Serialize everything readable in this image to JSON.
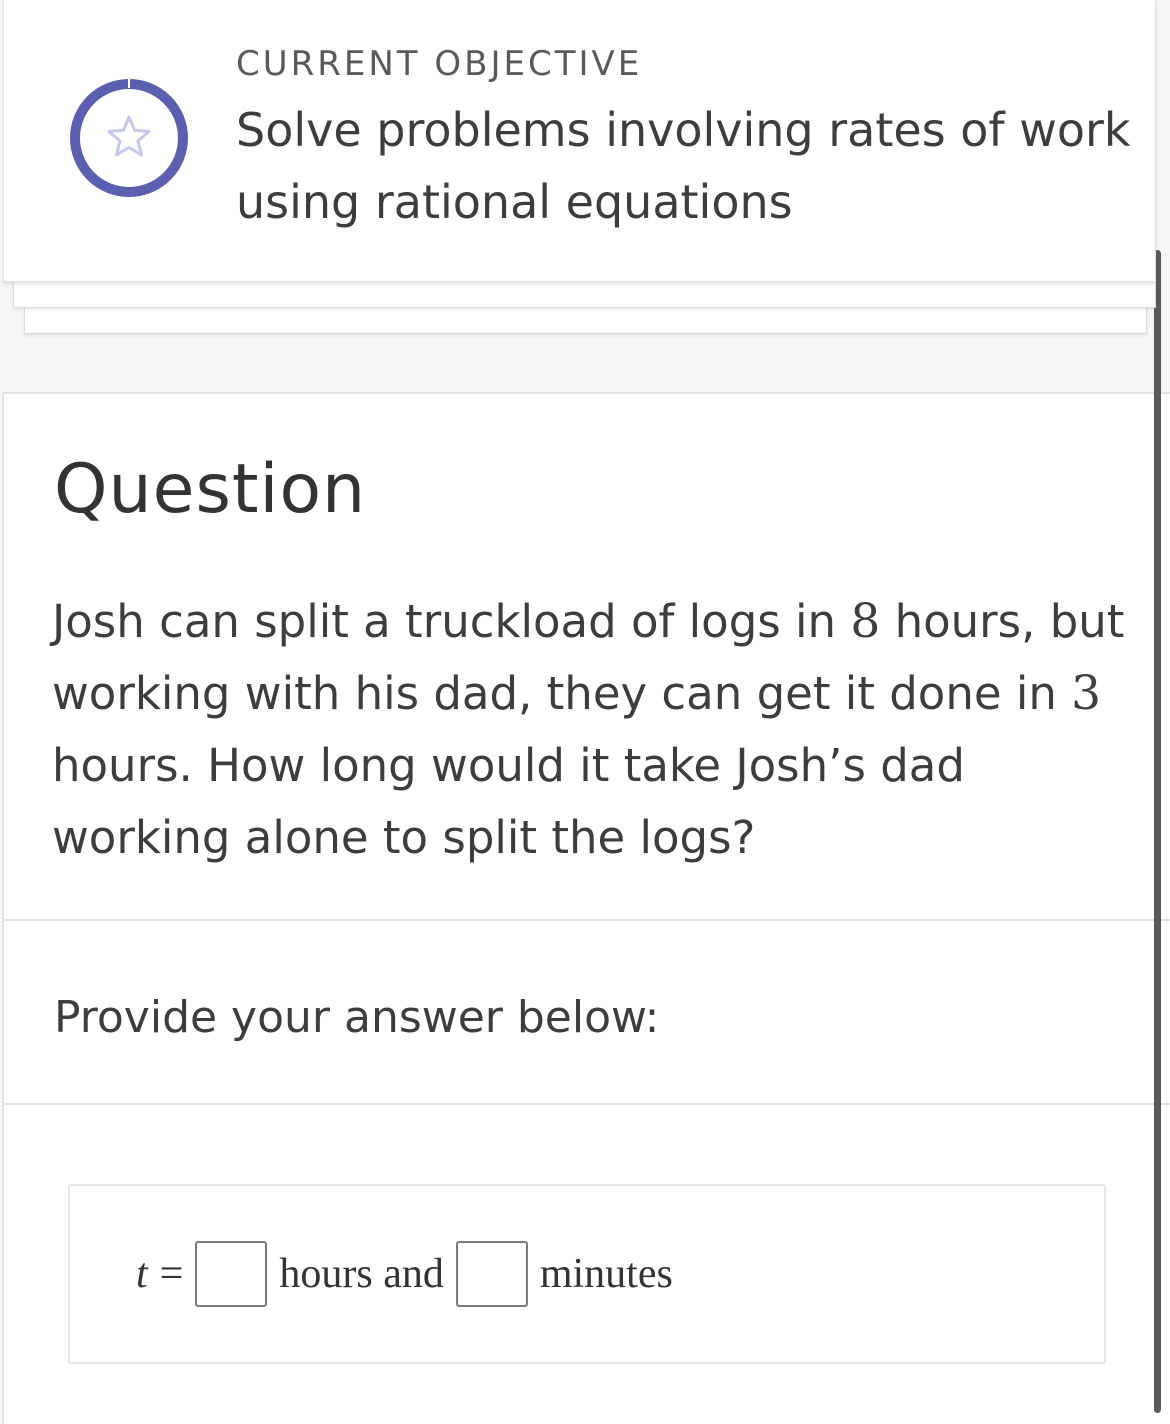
{
  "objective": {
    "label": "CURRENT OBJECTIVE",
    "title": "Solve problems involving rates of work using rational equations",
    "icon": "star-icon",
    "ring_color": "#5a5fb0",
    "star_color": "#c7c9ea"
  },
  "question": {
    "heading": "Question",
    "body_part1": "Josh can split a truckload of logs in ",
    "josh_hours": "8",
    "body_part2": " hours, but working with his dad, they can get it done in ",
    "together_hours": "3",
    "body_part3": " hours. How long would it take Josh’s dad working alone to split the logs?"
  },
  "answer": {
    "prompt": "Provide your answer below:",
    "variable": "t",
    "equals": "=",
    "hours_value": "",
    "hours_label": "hours and",
    "minutes_value": "",
    "minutes_label": "minutes"
  }
}
